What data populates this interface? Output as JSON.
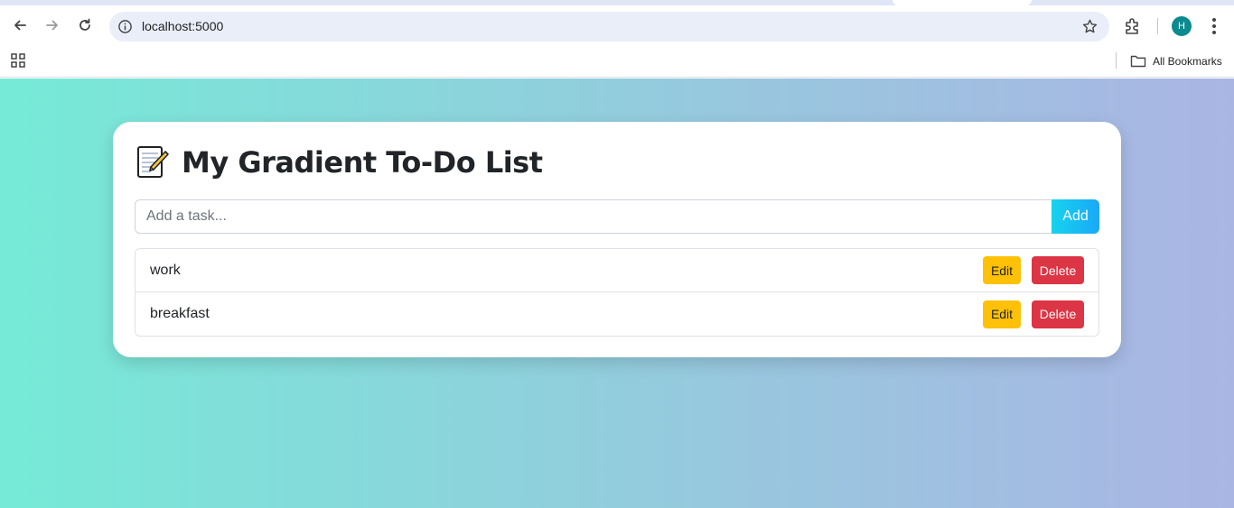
{
  "browser": {
    "url": "localhost:5000",
    "profile_initial": "H",
    "bookmarks_label": "All Bookmarks",
    "icons": {
      "back": "back-arrow-icon",
      "forward": "forward-arrow-icon",
      "reload": "reload-icon",
      "site_info": "site-info-icon",
      "bookmark_star": "star-icon",
      "extensions": "puzzle-icon",
      "menu": "kebab-menu-icon",
      "apps": "apps-grid-icon",
      "folder": "folder-icon"
    }
  },
  "app": {
    "title": "My Gradient To-Do List",
    "title_icon": "memo-icon",
    "input_placeholder": "Add a task...",
    "add_label": "Add",
    "tasks": [
      {
        "text": "work",
        "edit_label": "Edit",
        "delete_label": "Delete"
      },
      {
        "text": "breakfast",
        "edit_label": "Edit",
        "delete_label": "Delete"
      }
    ]
  },
  "colors": {
    "gradient_start": "#76ead7",
    "gradient_end": "#aab5e4",
    "add_button": "#1aa8f7",
    "edit_button": "#ffc107",
    "delete_button": "#dc3545",
    "avatar": "#0b8a8f"
  }
}
